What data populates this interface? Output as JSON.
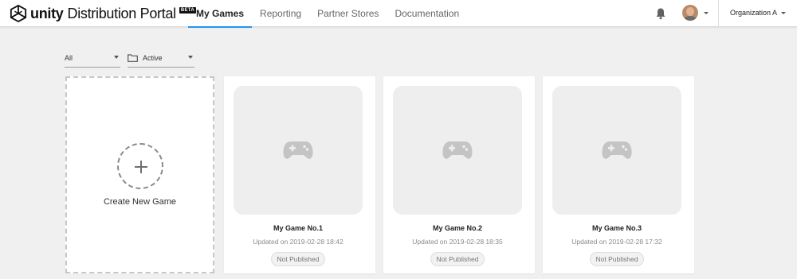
{
  "header": {
    "brand_word": "unity",
    "brand_sub": "Distribution Portal",
    "beta_badge": "BETA",
    "accent_color": "#2196f3",
    "icons": {
      "logo": "unity-logo-icon",
      "notifications": "bell-icon",
      "avatar": "user-avatar",
      "dropdown": "caret-down-icon"
    },
    "org_name": "Organization A"
  },
  "nav": {
    "tabs": [
      {
        "label": "My Games",
        "active": true
      },
      {
        "label": "Reporting",
        "active": false
      },
      {
        "label": "Partner Stores",
        "active": false
      },
      {
        "label": "Documentation",
        "active": false
      }
    ]
  },
  "filters": {
    "platform": {
      "value": "All"
    },
    "status": {
      "value": "Active",
      "icon": "folder-icon"
    }
  },
  "create_card": {
    "label": "Create New Game",
    "icon": "plus-circle-icon"
  },
  "games": [
    {
      "title": "My Game No.1",
      "updated": "Updated on 2019-02-28 18:42",
      "status": "Not Published",
      "icon": "gamepad-icon"
    },
    {
      "title": "My Game No.2",
      "updated": "Updated on 2019-02-28 18:35",
      "status": "Not Published",
      "icon": "gamepad-icon"
    },
    {
      "title": "My Game No.3",
      "updated": "Updated on 2019-02-28 17:32",
      "status": "Not Published",
      "icon": "gamepad-icon"
    }
  ]
}
